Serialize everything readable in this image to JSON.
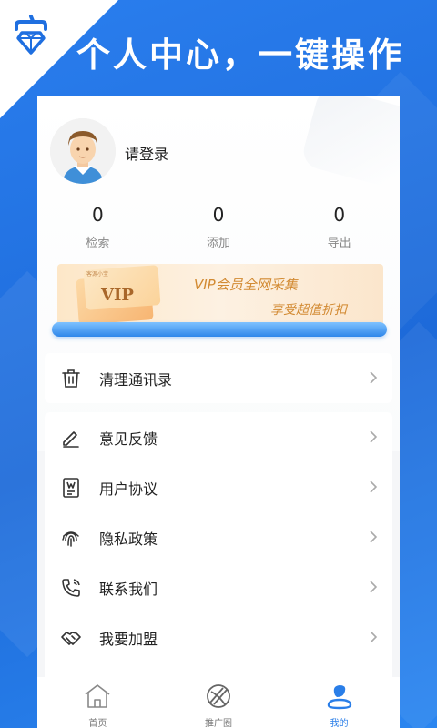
{
  "header": {
    "headline": "个人中心，一键操作"
  },
  "profile": {
    "login_prompt": "请登录",
    "stats": [
      {
        "value": "0",
        "label": "检索"
      },
      {
        "value": "0",
        "label": "添加"
      },
      {
        "value": "0",
        "label": "导出"
      }
    ]
  },
  "vip": {
    "card_label": "VIP",
    "card_small": "客源小宝",
    "title": "VIP会员全网采集",
    "subtitle": "享受超值折扣"
  },
  "menu_single": [
    {
      "label": "清理通讯录",
      "icon": "trash-icon"
    }
  ],
  "menu_group": [
    {
      "label": "意见反馈",
      "icon": "edit-icon"
    },
    {
      "label": "用户协议",
      "icon": "document-icon"
    },
    {
      "label": "隐私政策",
      "icon": "fingerprint-icon"
    },
    {
      "label": "联系我们",
      "icon": "phone-icon"
    },
    {
      "label": "我要加盟",
      "icon": "handshake-icon"
    }
  ],
  "tabbar": {
    "tabs": [
      {
        "label": "首页",
        "icon": "home-icon"
      },
      {
        "label": "推广圈",
        "icon": "circle-icon"
      },
      {
        "label": "我的",
        "icon": "profile-icon",
        "active": true
      }
    ]
  },
  "colors": {
    "brand_blue": "#2a7ee8",
    "vip_gold": "#d28a32"
  }
}
